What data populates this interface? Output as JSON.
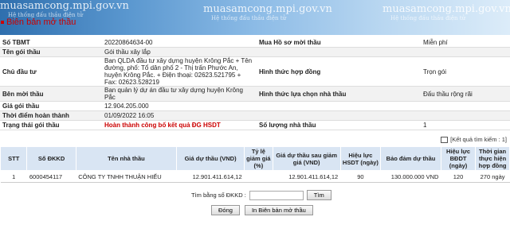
{
  "banner": {
    "watermarks": [
      {
        "url": "muasamcong.mpi.gov.vn",
        "sub": "Hệ thống đấu thầu điện tử"
      },
      {
        "url": "muasamcong.mpi.gov.vn",
        "sub": "Hệ thống đấu thầu điện tử"
      },
      {
        "url": "muasamcong.mpi.gov.vn",
        "sub": "Hệ thống đấu thầu điện tử"
      }
    ],
    "title": "Biên bản mở thầu"
  },
  "info": {
    "so_tbmt_label": "Số TBMT",
    "so_tbmt": "20220864634-00",
    "mua_hs_label": "Mua Hồ sơ mời thầu",
    "mua_hs": "Miễn phí",
    "ten_goi_label": "Tên gói thầu",
    "ten_goi": "Gói thầu xây lắp",
    "chu_dau_tu_label": "Chủ đầu tư",
    "chu_dau_tu": "Ban QLDA đầu tư xây dựng huyện Krông Pắc + Tên đường, phố: Tổ dân phố 2 - Thị trấn Phước An, huyện Krông Pắc. + Điện thoại: 02623.521795 + Fax: 02623.528219",
    "hinh_thuc_hd_label": "Hình thức hợp đồng",
    "hinh_thuc_hd": "Trọn gói",
    "ben_moi_label": "Bên mời thầu",
    "ben_moi": "Ban quản lý dự án đầu tư xây dựng huyện Krông Pắc",
    "hinh_thuc_lc_label": "Hình thức lựa chọn nhà thầu",
    "hinh_thuc_lc": "Đấu thầu rộng rãi",
    "gia_goi_label": "Giá gói thầu",
    "gia_goi": "12.904.205.000",
    "thoi_diem_label": "Thời điểm hoàn thành",
    "thoi_diem": "01/09/2022 16:05",
    "trang_thai_label": "Trạng thái gói thầu",
    "trang_thai": "Hoàn thành công bố kết quả ĐG HSDT",
    "so_luong_label": "Số lượng nhà thầu",
    "so_luong": "1"
  },
  "results_count": "[Kết quả tìm kiếm : 1]",
  "grid": {
    "headers": [
      "STT",
      "Số ĐKKD",
      "Tên nhà thầu",
      "Giá dự thầu (VND)",
      "Tỷ lệ giảm giá (%)",
      "Giá dự thầu sau giảm giá (VND)",
      "Hiệu lực HSDT (ngày)",
      "Bảo đảm dự thầu",
      "Hiệu lực BĐDT (ngày)",
      "Thời gian thực hiện hợp đồng"
    ],
    "row": [
      "1",
      "6000454117",
      "CÔNG TY TNHH THUẬN HIẾU",
      "12.901.411.614,12",
      "",
      "12.901.411.614,12",
      "90",
      "130.000.000 VND",
      "120",
      "270 ngày"
    ]
  },
  "search": {
    "label": "Tìm bằng số ĐKKD :",
    "button": "Tìm"
  },
  "actions": {
    "close": "Đóng",
    "print": "In Biên bản mở thầu"
  }
}
